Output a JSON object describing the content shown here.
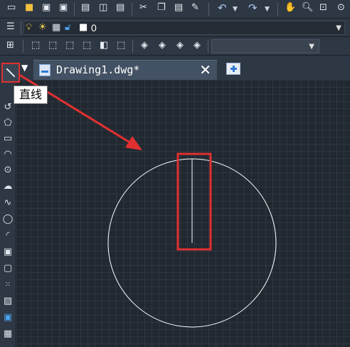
{
  "layer_toolbar": {
    "current_layer": "0"
  },
  "document_tab": {
    "title": "Drawing1.dwg*",
    "close_label": "✕"
  },
  "tooltip": {
    "text": "直线"
  },
  "colors": {
    "canvas_bg": "#212830",
    "toolbar_bg": "#2e3744",
    "highlight": "#e03030",
    "geometry": "#ffffff"
  },
  "icons": {
    "toolbar_row1": [
      "new-file-icon",
      "open-folder-icon",
      "save-icon",
      "save-as-icon",
      "print-icon",
      "plot-preview-icon",
      "publish-icon",
      "cut-icon",
      "copy-icon",
      "paste-icon",
      "match-properties-icon",
      "undo-icon",
      "redo-icon",
      "pan-icon",
      "zoom-realtime-icon",
      "zoom-window-icon",
      "zoom-previous-icon"
    ],
    "toolbar_row3": [
      "ucs-icon",
      "view-top-icon",
      "view-bottom-icon",
      "view-left-icon",
      "view-right-icon",
      "view-front-icon",
      "view-back-icon",
      "iso-sw-icon",
      "iso-se-icon",
      "iso-ne-icon",
      "iso-nw-icon"
    ],
    "palette": [
      "line-icon",
      "polyline-icon",
      "arc-icon",
      "polygon-icon",
      "rectangle-icon",
      "arc-3pt-icon",
      "circle-icon",
      "revision-cloud-icon",
      "spline-icon",
      "ellipse-icon",
      "ellipse-arc-icon",
      "insert-block-icon",
      "make-block-icon",
      "point-icon",
      "hatch-icon",
      "region-icon",
      "table-icon"
    ]
  }
}
